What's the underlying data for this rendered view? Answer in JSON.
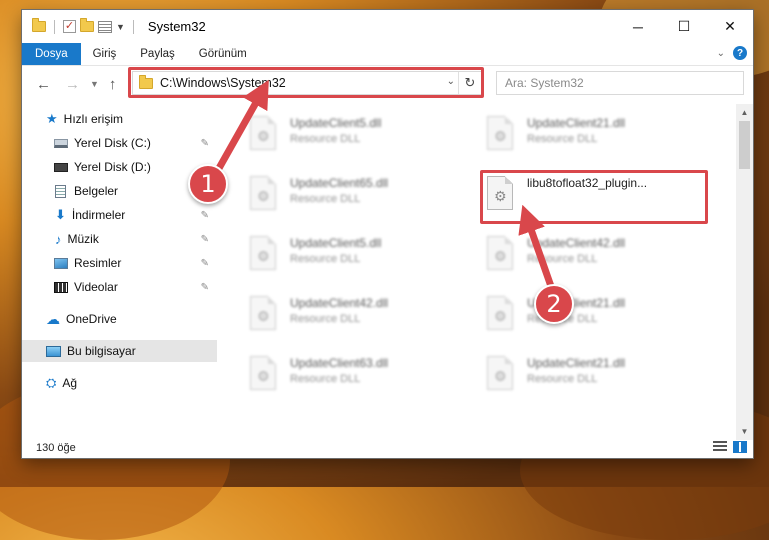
{
  "window": {
    "title": "System32"
  },
  "ribbon": {
    "tabs": [
      "Dosya",
      "Giriş",
      "Paylaş",
      "Görünüm"
    ]
  },
  "address": {
    "path": "C:\\Windows\\System32"
  },
  "search": {
    "placeholder": "Ara: System32"
  },
  "sidebar": {
    "items": [
      {
        "label": "Hızlı erişim",
        "icon": "star-icon"
      },
      {
        "label": "Yerel Disk (C:)",
        "icon": "drive-icon",
        "pinned": true
      },
      {
        "label": "Yerel Disk (D:)",
        "icon": "drive-icon"
      },
      {
        "label": "Belgeler",
        "icon": "documents-icon"
      },
      {
        "label": "İndirmeler",
        "icon": "downloads-icon",
        "pinned": true
      },
      {
        "label": "Müzik",
        "icon": "music-icon",
        "pinned": true
      },
      {
        "label": "Resimler",
        "icon": "pictures-icon",
        "pinned": true
      },
      {
        "label": "Videolar",
        "icon": "videos-icon",
        "pinned": true
      },
      {
        "label": "OneDrive",
        "icon": "cloud-icon"
      },
      {
        "label": "Bu bilgisayar",
        "icon": "computer-icon",
        "selected": true
      },
      {
        "label": "Ağ",
        "icon": "network-icon"
      }
    ]
  },
  "files": [
    {
      "name": "UpdateClient5.dll",
      "type": "Resource DLL"
    },
    {
      "name": "UpdateClient21.dll",
      "type": "Resource DLL"
    },
    {
      "name": "UpdateClient65.dll",
      "type": "Resource DLL"
    },
    {
      "name": "libu8tofloat32_plugin...",
      "type": ""
    },
    {
      "name": "UpdateClient5.dll",
      "type": "Resource DLL"
    },
    {
      "name": "UpdateClient42.dll",
      "type": "Resource DLL"
    },
    {
      "name": "UpdateClient42.dll",
      "type": "Resource DLL"
    },
    {
      "name": "UpdateClient21.dll",
      "type": "Resource DLL"
    },
    {
      "name": "UpdateClient63.dll",
      "type": "Resource DLL"
    },
    {
      "name": "UpdateClient21.dll",
      "type": "Resource DLL"
    }
  ],
  "status": {
    "item_count": "130 öğe"
  },
  "annotations": {
    "step1": "1",
    "step2": "2",
    "color": "#d9474b"
  }
}
